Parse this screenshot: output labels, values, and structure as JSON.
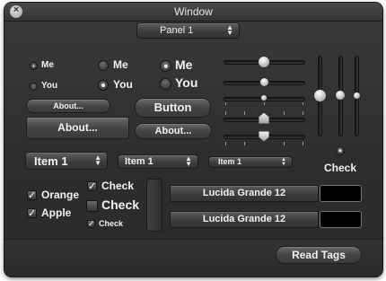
{
  "window": {
    "title": "Window",
    "close_glyph": "×"
  },
  "panel_popup": {
    "value": "Panel 1"
  },
  "radios": [
    {
      "label": "Me",
      "selected": true,
      "size": "small"
    },
    {
      "label": "You",
      "selected": false,
      "size": "small"
    },
    {
      "label": "Me",
      "selected": false,
      "size": "medium"
    },
    {
      "label": "You",
      "selected": true,
      "size": "medium"
    },
    {
      "label": "Me",
      "selected": true,
      "size": "large"
    },
    {
      "label": "You",
      "selected": false,
      "size": "large"
    }
  ],
  "buttons": {
    "about_small": "About...",
    "about_square": "About...",
    "button_large": "Button",
    "about_round": "About...",
    "read_tags": "Read Tags"
  },
  "popups": [
    {
      "value": "Item 1",
      "size": "large"
    },
    {
      "value": "Item 1",
      "size": "medium"
    },
    {
      "value": "Item 1",
      "size": "small"
    }
  ],
  "checkboxes_left": [
    {
      "label": "Orange",
      "checked": true
    },
    {
      "label": "Apple",
      "checked": true
    }
  ],
  "checkboxes_mid": [
    {
      "label": "Check",
      "checked": true,
      "size": "medium"
    },
    {
      "label": "Check",
      "checked": false,
      "size": "large"
    },
    {
      "label": "Check",
      "checked": true,
      "size": "small"
    }
  ],
  "font_rows": [
    {
      "label": "Lucida Grande 12",
      "color": "#000000"
    },
    {
      "label": "Lucida Grande 12",
      "color": "#000000"
    }
  ],
  "horizontal_sliders": [
    {
      "value": 0.55,
      "knob": "round-large"
    },
    {
      "value": 0.55,
      "knob": "round-medium"
    },
    {
      "value": 0.55,
      "knob": "round-small",
      "ticks": true
    },
    {
      "value": 0.55,
      "knob": "pointer-up",
      "ticks": true
    },
    {
      "value": 0.55,
      "knob": "pointer-down",
      "ticks": true
    }
  ],
  "vertical_sliders": [
    {
      "value": 0.5,
      "knob": "round-large"
    },
    {
      "value": 0.5,
      "knob": "round-medium"
    },
    {
      "value": 0.5,
      "knob": "round-small"
    }
  ],
  "check_radio": {
    "label": "Check",
    "selected": true
  }
}
